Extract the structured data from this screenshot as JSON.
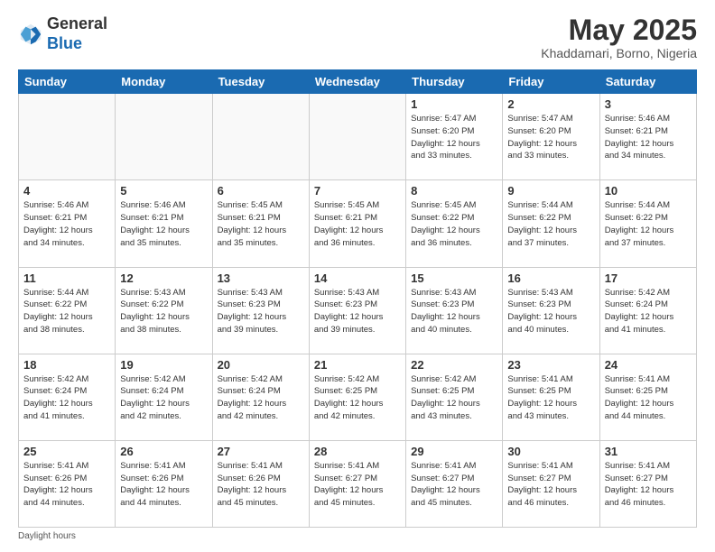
{
  "header": {
    "logo_general": "General",
    "logo_blue": "Blue",
    "month_title": "May 2025",
    "location": "Khaddamari, Borno, Nigeria"
  },
  "days_of_week": [
    "Sunday",
    "Monday",
    "Tuesday",
    "Wednesday",
    "Thursday",
    "Friday",
    "Saturday"
  ],
  "footer": {
    "daylight_hours": "Daylight hours"
  },
  "weeks": [
    [
      {
        "day": "",
        "info": ""
      },
      {
        "day": "",
        "info": ""
      },
      {
        "day": "",
        "info": ""
      },
      {
        "day": "",
        "info": ""
      },
      {
        "day": "1",
        "info": "Sunrise: 5:47 AM\nSunset: 6:20 PM\nDaylight: 12 hours\nand 33 minutes."
      },
      {
        "day": "2",
        "info": "Sunrise: 5:47 AM\nSunset: 6:20 PM\nDaylight: 12 hours\nand 33 minutes."
      },
      {
        "day": "3",
        "info": "Sunrise: 5:46 AM\nSunset: 6:21 PM\nDaylight: 12 hours\nand 34 minutes."
      }
    ],
    [
      {
        "day": "4",
        "info": "Sunrise: 5:46 AM\nSunset: 6:21 PM\nDaylight: 12 hours\nand 34 minutes."
      },
      {
        "day": "5",
        "info": "Sunrise: 5:46 AM\nSunset: 6:21 PM\nDaylight: 12 hours\nand 35 minutes."
      },
      {
        "day": "6",
        "info": "Sunrise: 5:45 AM\nSunset: 6:21 PM\nDaylight: 12 hours\nand 35 minutes."
      },
      {
        "day": "7",
        "info": "Sunrise: 5:45 AM\nSunset: 6:21 PM\nDaylight: 12 hours\nand 36 minutes."
      },
      {
        "day": "8",
        "info": "Sunrise: 5:45 AM\nSunset: 6:22 PM\nDaylight: 12 hours\nand 36 minutes."
      },
      {
        "day": "9",
        "info": "Sunrise: 5:44 AM\nSunset: 6:22 PM\nDaylight: 12 hours\nand 37 minutes."
      },
      {
        "day": "10",
        "info": "Sunrise: 5:44 AM\nSunset: 6:22 PM\nDaylight: 12 hours\nand 37 minutes."
      }
    ],
    [
      {
        "day": "11",
        "info": "Sunrise: 5:44 AM\nSunset: 6:22 PM\nDaylight: 12 hours\nand 38 minutes."
      },
      {
        "day": "12",
        "info": "Sunrise: 5:43 AM\nSunset: 6:22 PM\nDaylight: 12 hours\nand 38 minutes."
      },
      {
        "day": "13",
        "info": "Sunrise: 5:43 AM\nSunset: 6:23 PM\nDaylight: 12 hours\nand 39 minutes."
      },
      {
        "day": "14",
        "info": "Sunrise: 5:43 AM\nSunset: 6:23 PM\nDaylight: 12 hours\nand 39 minutes."
      },
      {
        "day": "15",
        "info": "Sunrise: 5:43 AM\nSunset: 6:23 PM\nDaylight: 12 hours\nand 40 minutes."
      },
      {
        "day": "16",
        "info": "Sunrise: 5:43 AM\nSunset: 6:23 PM\nDaylight: 12 hours\nand 40 minutes."
      },
      {
        "day": "17",
        "info": "Sunrise: 5:42 AM\nSunset: 6:24 PM\nDaylight: 12 hours\nand 41 minutes."
      }
    ],
    [
      {
        "day": "18",
        "info": "Sunrise: 5:42 AM\nSunset: 6:24 PM\nDaylight: 12 hours\nand 41 minutes."
      },
      {
        "day": "19",
        "info": "Sunrise: 5:42 AM\nSunset: 6:24 PM\nDaylight: 12 hours\nand 42 minutes."
      },
      {
        "day": "20",
        "info": "Sunrise: 5:42 AM\nSunset: 6:24 PM\nDaylight: 12 hours\nand 42 minutes."
      },
      {
        "day": "21",
        "info": "Sunrise: 5:42 AM\nSunset: 6:25 PM\nDaylight: 12 hours\nand 42 minutes."
      },
      {
        "day": "22",
        "info": "Sunrise: 5:42 AM\nSunset: 6:25 PM\nDaylight: 12 hours\nand 43 minutes."
      },
      {
        "day": "23",
        "info": "Sunrise: 5:41 AM\nSunset: 6:25 PM\nDaylight: 12 hours\nand 43 minutes."
      },
      {
        "day": "24",
        "info": "Sunrise: 5:41 AM\nSunset: 6:25 PM\nDaylight: 12 hours\nand 44 minutes."
      }
    ],
    [
      {
        "day": "25",
        "info": "Sunrise: 5:41 AM\nSunset: 6:26 PM\nDaylight: 12 hours\nand 44 minutes."
      },
      {
        "day": "26",
        "info": "Sunrise: 5:41 AM\nSunset: 6:26 PM\nDaylight: 12 hours\nand 44 minutes."
      },
      {
        "day": "27",
        "info": "Sunrise: 5:41 AM\nSunset: 6:26 PM\nDaylight: 12 hours\nand 45 minutes."
      },
      {
        "day": "28",
        "info": "Sunrise: 5:41 AM\nSunset: 6:27 PM\nDaylight: 12 hours\nand 45 minutes."
      },
      {
        "day": "29",
        "info": "Sunrise: 5:41 AM\nSunset: 6:27 PM\nDaylight: 12 hours\nand 45 minutes."
      },
      {
        "day": "30",
        "info": "Sunrise: 5:41 AM\nSunset: 6:27 PM\nDaylight: 12 hours\nand 46 minutes."
      },
      {
        "day": "31",
        "info": "Sunrise: 5:41 AM\nSunset: 6:27 PM\nDaylight: 12 hours\nand 46 minutes."
      }
    ]
  ]
}
